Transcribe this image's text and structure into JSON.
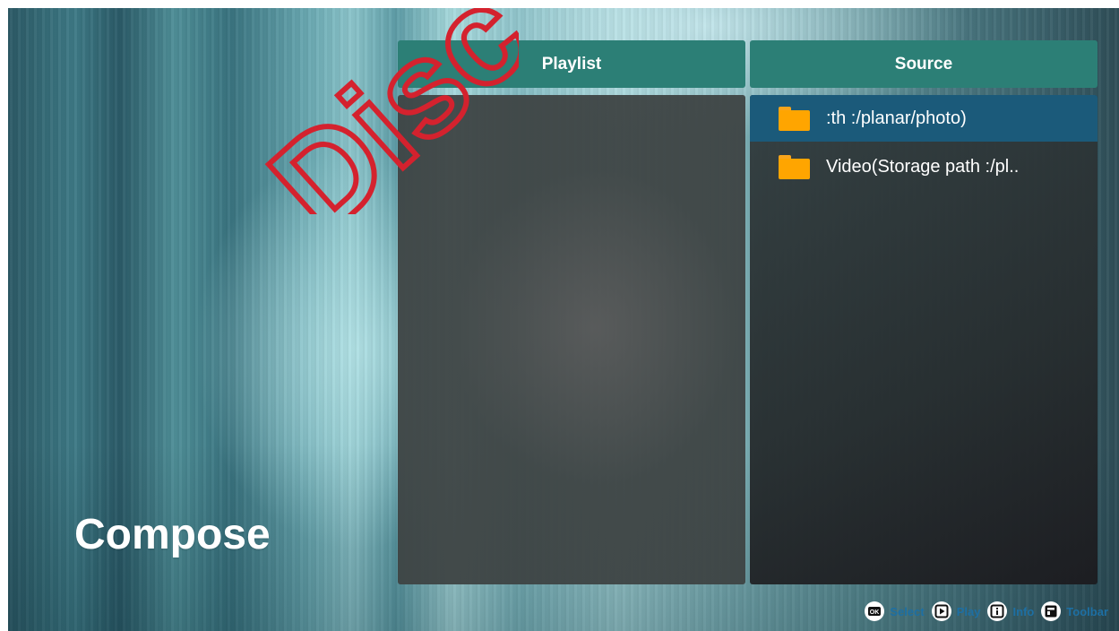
{
  "watermark": {
    "text": "Disc"
  },
  "page_title": "Compose",
  "playlist": {
    "header": "Playlist",
    "items": []
  },
  "source": {
    "header": "Source",
    "items": [
      {
        "label": ":th :/planar/photo)",
        "icon": "folder-icon",
        "selected": true
      },
      {
        "label": "Video(Storage path :/pl..",
        "icon": "folder-icon",
        "selected": false
      }
    ]
  },
  "hints": [
    {
      "icon": "ok-icon",
      "label": "Select"
    },
    {
      "icon": "play-icon",
      "label": "Play"
    },
    {
      "icon": "info-icon",
      "label": "Info"
    },
    {
      "icon": "toolbar-icon",
      "label": "Toolbar"
    }
  ],
  "colors": {
    "header_bg": "#2c7f76",
    "selected_row": "#1b5a7a",
    "folder": "#ffa500",
    "hint_text": "#1d6fa3",
    "watermark": "#d4222e"
  }
}
